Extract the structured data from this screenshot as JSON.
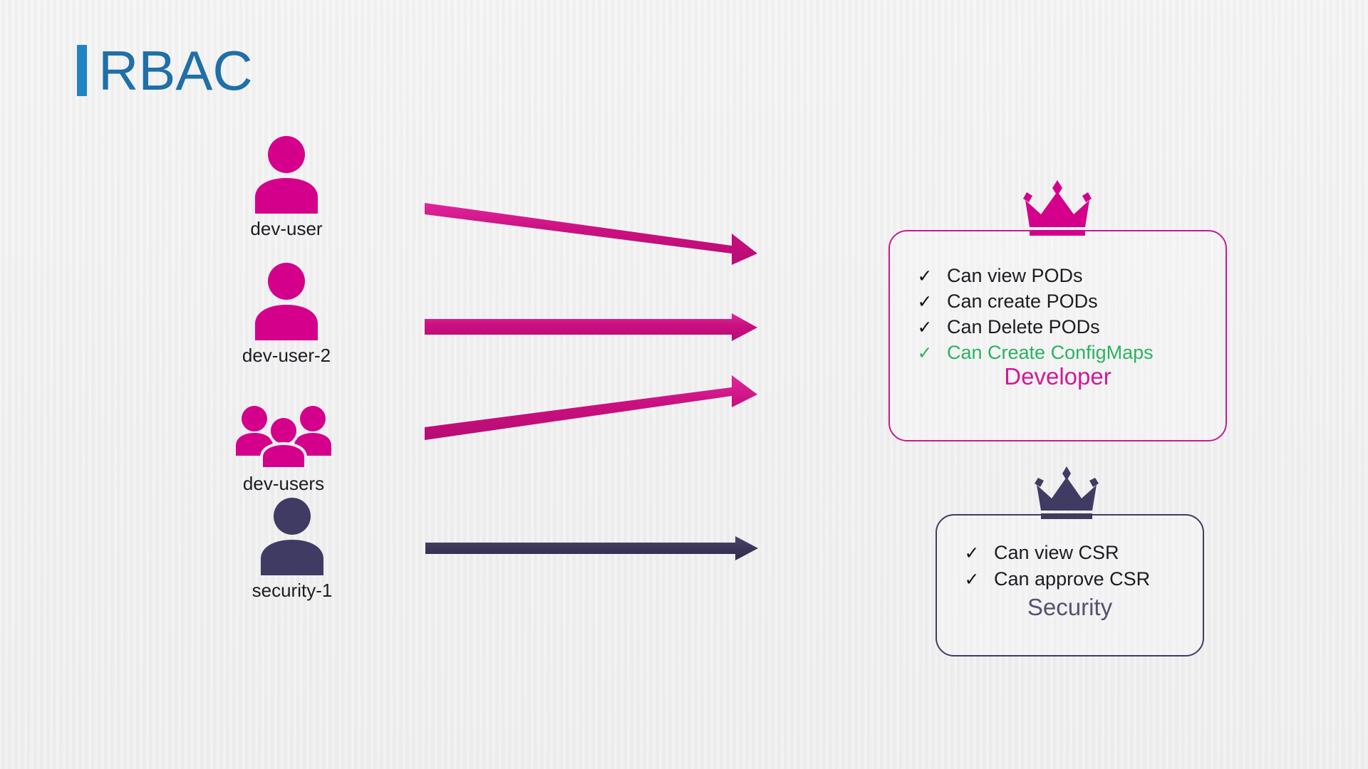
{
  "title": {
    "text": "RBAC",
    "bar_color": "#2084c4",
    "text_color": "#1f6fa8"
  },
  "colors": {
    "background": "#f1f1f1",
    "magenta": "#c9107f",
    "magenta_light": "#d4179a",
    "navy": "#403c62",
    "navy_light": "#55516f",
    "green": "#2cb261",
    "text": "#1c1c22"
  },
  "subjects": [
    {
      "id": "dev-user",
      "label": "dev-user",
      "icon": "user-icon",
      "color": "#d4008c"
    },
    {
      "id": "dev-user-2",
      "label": "dev-user-2",
      "icon": "user-icon",
      "color": "#d4008c"
    },
    {
      "id": "dev-users",
      "label": "dev-users",
      "icon": "users-group-icon",
      "color": "#d4008c"
    },
    {
      "id": "security-1",
      "label": "security-1",
      "icon": "user-icon",
      "color": "#403b63"
    }
  ],
  "arrows": [
    {
      "id": "arrow-dev-user-to-developer",
      "color": "#c9107f",
      "direction": "right-down"
    },
    {
      "id": "arrow-dev-user-2-to-developer",
      "color": "#c9107f",
      "direction": "right"
    },
    {
      "id": "arrow-dev-users-to-developer",
      "color": "#c9107f",
      "direction": "right-up"
    },
    {
      "id": "arrow-security-1-to-security",
      "color": "#403c62",
      "direction": "right"
    }
  ],
  "roles": [
    {
      "id": "developer",
      "name": "Developer",
      "crown": "crown-icon",
      "border_color": "#c41c94",
      "name_color": "#d4179a",
      "permissions": [
        {
          "check": "✓",
          "text": "Can view PODs",
          "color": "#1c1c22",
          "check_color": "#111111"
        },
        {
          "check": "✓",
          "text": "Can create PODs",
          "color": "#1c1c22",
          "check_color": "#111111"
        },
        {
          "check": "✓",
          "text": "Can Delete PODs",
          "color": "#1c1c22",
          "check_color": "#111111"
        },
        {
          "check": "✓",
          "text": "Can Create ConfigMaps",
          "color": "#2cb261",
          "check_color": "#2cb261"
        }
      ]
    },
    {
      "id": "security",
      "name": "Security",
      "crown": "crown-icon",
      "border_color": "#403c62",
      "name_color": "#55516f",
      "permissions": [
        {
          "check": "✓",
          "text": "Can view CSR",
          "color": "#1c1c22",
          "check_color": "#111111"
        },
        {
          "check": "✓",
          "text": "Can approve CSR",
          "color": "#1c1c22",
          "check_color": "#111111"
        }
      ]
    }
  ]
}
